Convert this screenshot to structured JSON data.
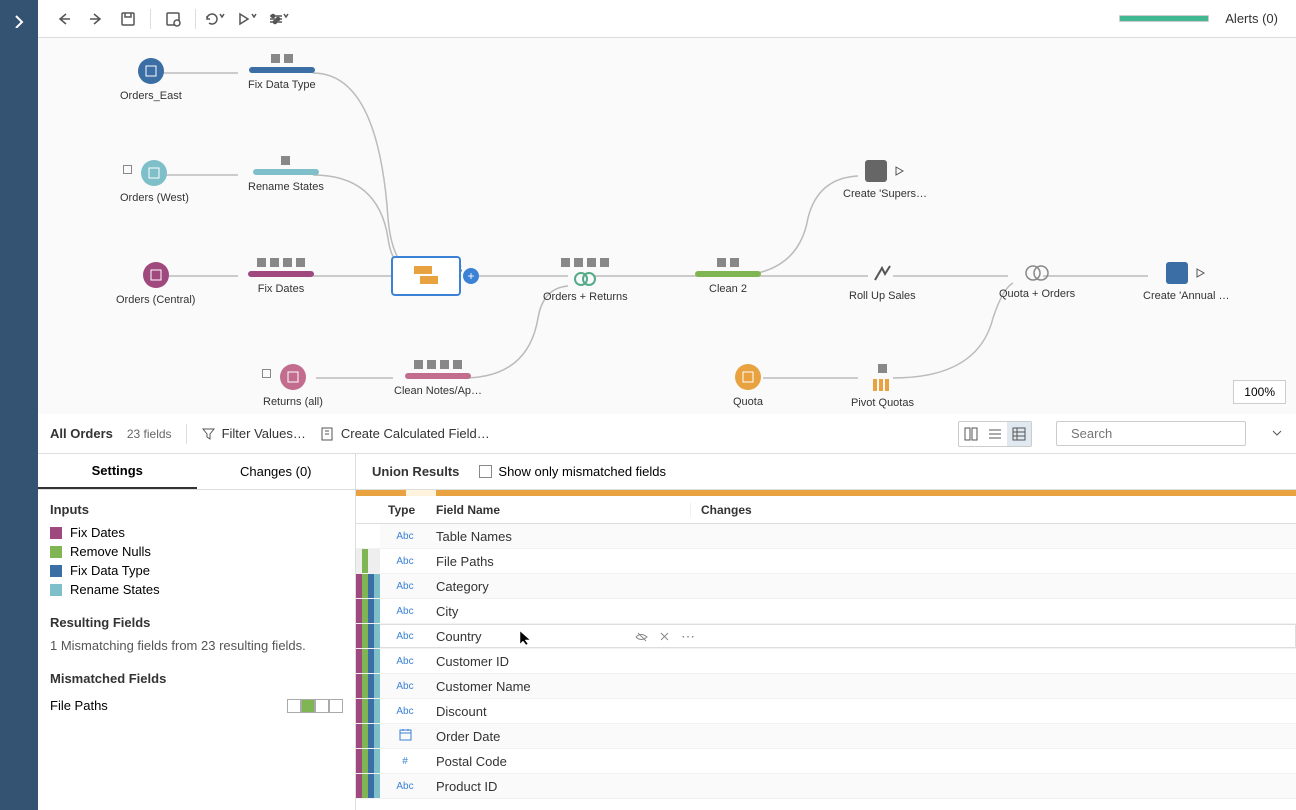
{
  "toolbar": {
    "alerts_label": "Alerts (0)"
  },
  "zoom": "100%",
  "flow": {
    "nodes": {
      "orders_east": "Orders_East",
      "fix_data_type": "Fix Data Type",
      "orders_west": "Orders (West)",
      "rename_states": "Rename States",
      "orders_central": "Orders (Central)",
      "fix_dates": "Fix Dates",
      "returns_all": "Returns (all)",
      "all_orders": "All Orders",
      "clean_notes": "Clean Notes/Ap…",
      "orders_returns": "Orders + Returns",
      "clean_2": "Clean 2",
      "roll_up_sales": "Roll Up Sales",
      "quota": "Quota",
      "pivot_quotas": "Pivot Quotas",
      "quota_orders": "Quota + Orders",
      "create_supers": "Create 'Supers…",
      "create_annual": "Create 'Annual …"
    }
  },
  "panel": {
    "title": "All Orders",
    "field_count": "23 fields",
    "filter_label": "Filter Values…",
    "calc_label": "Create Calculated Field…",
    "search_placeholder": "Search"
  },
  "tabs": {
    "settings": "Settings",
    "changes": "Changes (0)"
  },
  "sidebar": {
    "inputs_label": "Inputs",
    "inputs": [
      {
        "label": "Fix Dates",
        "color": "#a0497f"
      },
      {
        "label": "Remove Nulls",
        "color": "#7fb653"
      },
      {
        "label": "Fix Data Type",
        "color": "#3a6ea5"
      },
      {
        "label": "Rename States",
        "color": "#7ebfc9"
      }
    ],
    "resulting_label": "Resulting Fields",
    "resulting_desc": "1 Mismatching fields from 23 resulting fields.",
    "mismatched_label": "Mismatched Fields",
    "mismatched_item": "File Paths"
  },
  "union": {
    "title": "Union Results",
    "mismatch_label": "Show only mismatched fields",
    "headers": {
      "type": "Type",
      "field_name": "Field Name",
      "changes": "Changes"
    }
  },
  "rows": [
    {
      "type": "Abc",
      "name": "Table Names",
      "bands": [
        "#fff",
        "#fff",
        "#fff",
        "#fff"
      ]
    },
    {
      "type": "Abc",
      "name": "File Paths",
      "bands": [
        "#eee",
        "#7fb653",
        "#eee",
        "#eee"
      ]
    },
    {
      "type": "Abc",
      "name": "Category",
      "bands": [
        "#a0497f",
        "#7fb653",
        "#3a6ea5",
        "#7ebfc9"
      ]
    },
    {
      "type": "Abc",
      "name": "City",
      "bands": [
        "#a0497f",
        "#7fb653",
        "#3a6ea5",
        "#7ebfc9"
      ]
    },
    {
      "type": "Abc",
      "name": "Country",
      "bands": [
        "#a0497f",
        "#7fb653",
        "#3a6ea5",
        "#7ebfc9"
      ],
      "hover": true
    },
    {
      "type": "Abc",
      "name": "Customer ID",
      "bands": [
        "#a0497f",
        "#7fb653",
        "#3a6ea5",
        "#7ebfc9"
      ]
    },
    {
      "type": "Abc",
      "name": "Customer Name",
      "bands": [
        "#a0497f",
        "#7fb653",
        "#3a6ea5",
        "#7ebfc9"
      ]
    },
    {
      "type": "Abc",
      "name": "Discount",
      "bands": [
        "#a0497f",
        "#7fb653",
        "#3a6ea5",
        "#7ebfc9"
      ]
    },
    {
      "type": "date",
      "name": "Order Date",
      "bands": [
        "#a0497f",
        "#7fb653",
        "#3a6ea5",
        "#7ebfc9"
      ]
    },
    {
      "type": "#",
      "name": "Postal Code",
      "bands": [
        "#a0497f",
        "#7fb653",
        "#3a6ea5",
        "#7ebfc9"
      ]
    },
    {
      "type": "Abc",
      "name": "Product ID",
      "bands": [
        "#a0497f",
        "#7fb653",
        "#3a6ea5",
        "#7ebfc9"
      ]
    }
  ]
}
